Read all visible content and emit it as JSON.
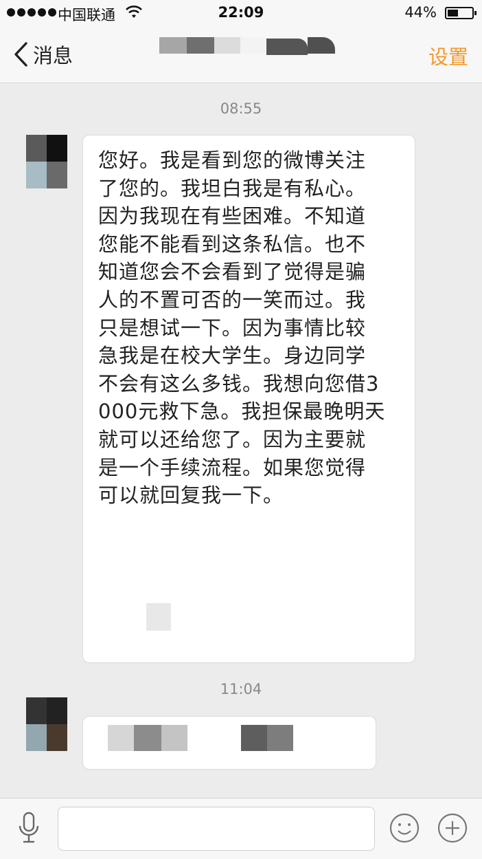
{
  "status_bar": {
    "carrier": "中国联通",
    "time": "22:09",
    "battery_percent": "44%",
    "battery_level": 0.44,
    "signal_dots": 5
  },
  "nav": {
    "back_label": "消息",
    "settings_label": "设置",
    "accent_color": "#f39a2d"
  },
  "messages": [
    {
      "timestamp": "08:55",
      "text": "您好。我是看到您的微博关注\n了您的。我坦白我是有私心。\n因为我现在有些困难。不知道\n您能不能看到这条私信。也不\n知道您会不会看到了觉得是骗\n人的不置可否的一笑而过。我\n只是想试一下。因为事情比较\n急我是在校大学生。身边同学\n不会有这么多钱。我想向您借3\n000元救下急。我担保最晚明天\n就可以还给您了。因为主要就\n是一个手续流程。如果您觉得\n可以就回复我一下。"
    },
    {
      "timestamp": "11:04"
    }
  ],
  "input_bar": {
    "placeholder": ""
  },
  "icons": {
    "back": "chevron-left-icon",
    "mic": "microphone-icon",
    "emoji": "smiley-icon",
    "plus": "plus-circle-icon",
    "wifi": "wifi-icon",
    "battery": "battery-icon"
  }
}
